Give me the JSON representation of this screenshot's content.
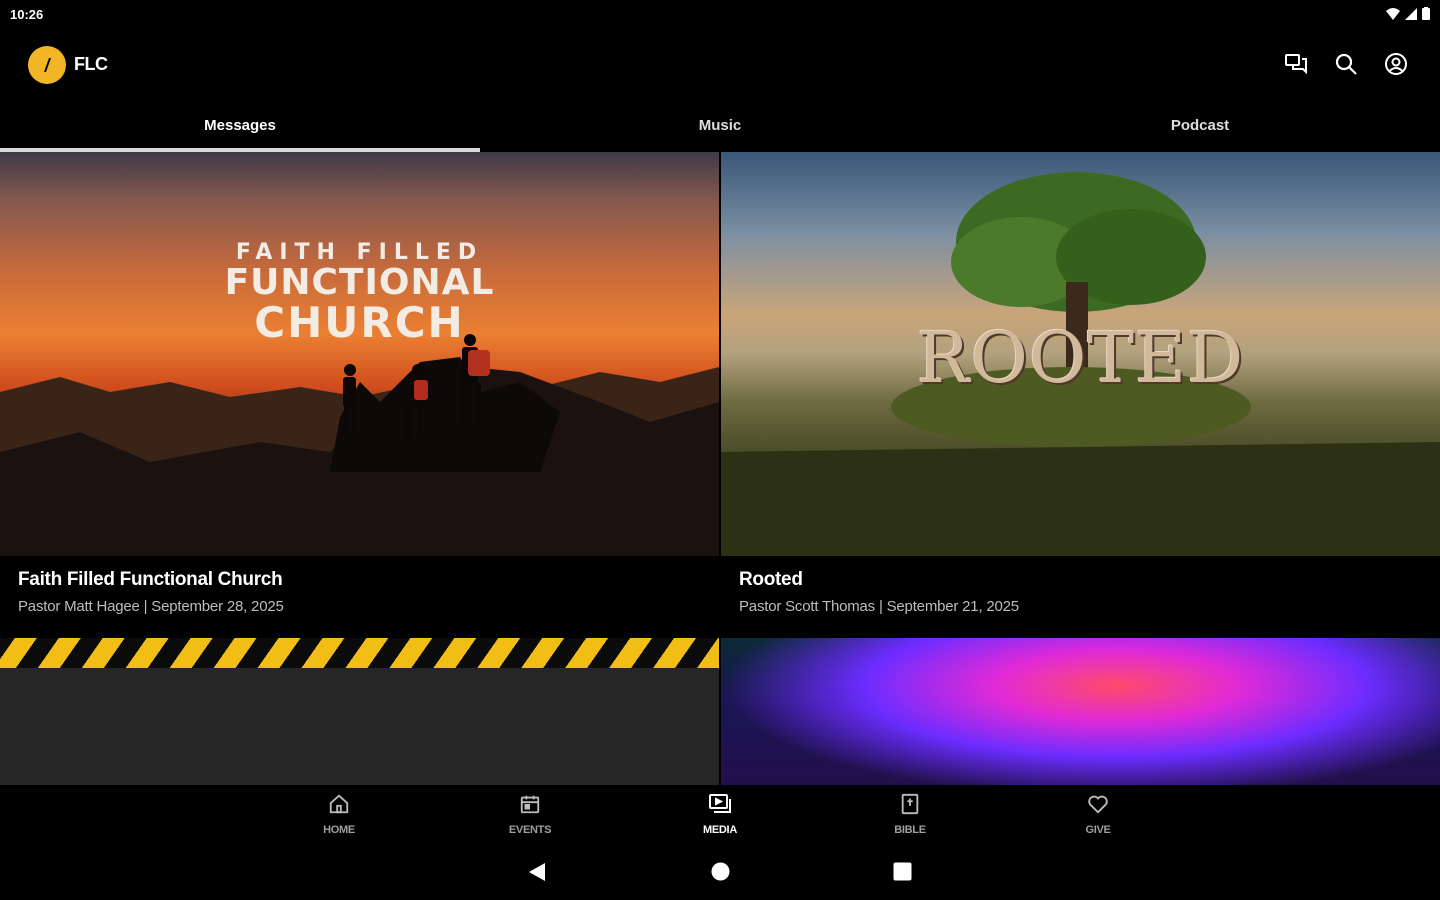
{
  "status_bar": {
    "time": "10:26"
  },
  "header": {
    "app_name": "FLC"
  },
  "tabs": [
    {
      "label": "Messages",
      "active": true
    },
    {
      "label": "Music",
      "active": false
    },
    {
      "label": "Podcast",
      "active": false
    }
  ],
  "messages": [
    {
      "title": "Faith Filled Functional Church",
      "subtitle": "Pastor Matt Hagee | September 28, 2025",
      "artwork_text": [
        "FAITH FILLED",
        "FUNCTIONAL",
        "CHURCH"
      ]
    },
    {
      "title": "Rooted",
      "subtitle": "Pastor Scott Thomas | September 21, 2025",
      "artwork_text": [
        "ROOTED"
      ]
    }
  ],
  "bottom_nav": [
    {
      "label": "HOME",
      "icon": "home-icon"
    },
    {
      "label": "EVENTS",
      "icon": "calendar-icon"
    },
    {
      "label": "MEDIA",
      "icon": "media-icon",
      "active": true
    },
    {
      "label": "BIBLE",
      "icon": "bible-icon"
    },
    {
      "label": "GIVE",
      "icon": "heart-icon"
    }
  ],
  "colors": {
    "brand_accent": "#f2b526",
    "background": "#000000",
    "tab_indicator": "#d9d9d9"
  }
}
